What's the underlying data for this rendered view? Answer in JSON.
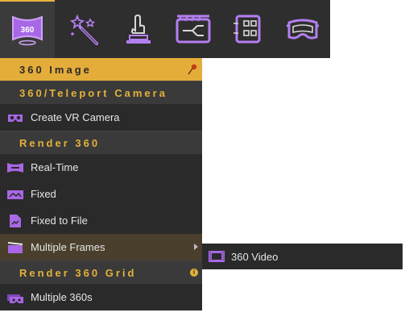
{
  "toolbar": {
    "buttons": [
      {
        "name": "360-image-icon",
        "label": "360"
      },
      {
        "name": "magic-wand-icon"
      },
      {
        "name": "touch-pointer-icon"
      },
      {
        "name": "film-clapper-icon"
      },
      {
        "name": "grid-panel-icon"
      },
      {
        "name": "vr-headset-icon"
      }
    ],
    "accent_color": "#e4ad3a"
  },
  "menu": {
    "title": "360 Image",
    "sections": {
      "teleport": "360/Teleport Camera",
      "render360": "Render 360",
      "render360grid": "Render 360 Grid"
    },
    "items": {
      "create_vr_camera": "Create VR Camera",
      "real_time": "Real-Time",
      "fixed": "Fixed",
      "fixed_to_file": "Fixed to File",
      "multiple_frames": "Multiple Frames",
      "multiple_360s": "Multiple 360s"
    },
    "info_glyph": "i"
  },
  "submenu": {
    "video_360": "360 Video"
  }
}
